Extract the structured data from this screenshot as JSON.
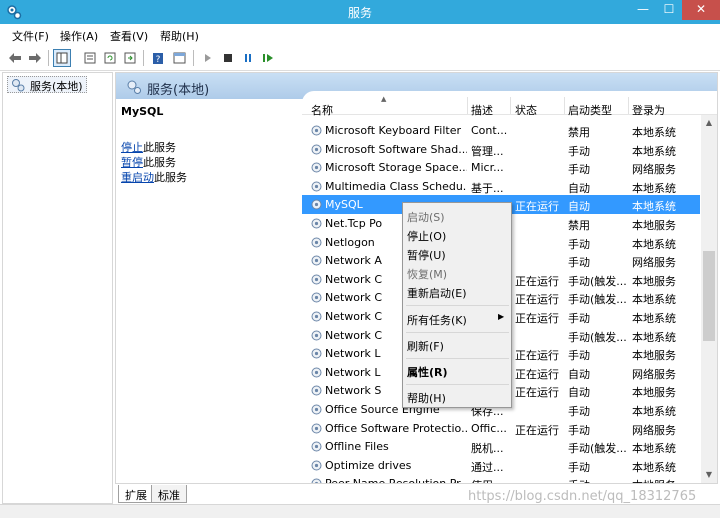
{
  "window": {
    "title": "服务",
    "icon": "services-gear-icon"
  },
  "window_controls": {
    "minimize": "—",
    "maximize": "☐",
    "close": "✕"
  },
  "menubar": [
    "文件(F)",
    "操作(A)",
    "查看(V)",
    "帮助(H)"
  ],
  "toolbar": {
    "icons": [
      "back-arrow-icon",
      "forward-arrow-icon",
      "console-tree-icon",
      "properties-icon",
      "refresh-icon",
      "export-list-icon",
      "help-icon",
      "mmc-view-icon",
      "play-icon",
      "stop-icon",
      "pause-icon",
      "restart-icon"
    ]
  },
  "tree": {
    "node": "服务(本地)"
  },
  "pane": {
    "header": "服务(本地)",
    "service_name": "MySQL",
    "actions": [
      {
        "link": "停止",
        "rest": "此服务"
      },
      {
        "link": "暂停",
        "rest": "此服务"
      },
      {
        "link": "重启动",
        "rest": "此服务"
      }
    ]
  },
  "columns": {
    "name": "名称",
    "desc": "描述",
    "status": "状态",
    "startup": "启动类型",
    "logon": "登录为"
  },
  "rows": [
    {
      "name": "Microsoft Keyboard Filter",
      "desc": "Cont...",
      "status": "",
      "startup": "禁用",
      "logon": "本地系统"
    },
    {
      "name": "Microsoft Software Shad...",
      "desc": "管理...",
      "status": "",
      "startup": "手动",
      "logon": "本地系统"
    },
    {
      "name": "Microsoft Storage Space...",
      "desc": "Micr...",
      "status": "",
      "startup": "手动",
      "logon": "网络服务"
    },
    {
      "name": "Multimedia Class Schedu...",
      "desc": "基于...",
      "status": "",
      "startup": "自动",
      "logon": "本地系统"
    },
    {
      "name": "MySQL",
      "desc": "",
      "status": "正在运行",
      "startup": "自动",
      "logon": "本地系统"
    },
    {
      "name": "Net.Tcp Po",
      "desc": "",
      "status": "",
      "startup": "禁用",
      "logon": "本地服务"
    },
    {
      "name": "Netlogon",
      "desc": "",
      "status": "",
      "startup": "手动",
      "logon": "本地系统"
    },
    {
      "name": "Network A",
      "desc": "",
      "status": "",
      "startup": "手动",
      "logon": "网络服务"
    },
    {
      "name": "Network C",
      "desc": "",
      "status": "正在运行",
      "startup": "手动(触发...",
      "logon": "本地服务"
    },
    {
      "name": "Network C",
      "desc": "",
      "status": "正在运行",
      "startup": "手动(触发...",
      "logon": "本地系统"
    },
    {
      "name": "Network C",
      "desc": "",
      "status": "正在运行",
      "startup": "手动",
      "logon": "本地系统"
    },
    {
      "name": "Network C",
      "desc": "",
      "status": "",
      "startup": "手动(触发...",
      "logon": "本地系统"
    },
    {
      "name": "Network L",
      "desc": "",
      "status": "正在运行",
      "startup": "手动",
      "logon": "本地服务"
    },
    {
      "name": "Network L",
      "desc": "",
      "status": "正在运行",
      "startup": "自动",
      "logon": "网络服务"
    },
    {
      "name": "Network S",
      "desc": "",
      "status": "正在运行",
      "startup": "自动",
      "logon": "本地服务"
    },
    {
      "name": "Office Source Engine",
      "desc": "保存...",
      "status": "",
      "startup": "手动",
      "logon": "本地系统"
    },
    {
      "name": "Office Software Protectio...",
      "desc": "Offic...",
      "status": "正在运行",
      "startup": "手动",
      "logon": "网络服务"
    },
    {
      "name": "Offline Files",
      "desc": "脱机...",
      "status": "",
      "startup": "手动(触发...",
      "logon": "本地系统"
    },
    {
      "name": "Optimize drives",
      "desc": "通过...",
      "status": "",
      "startup": "手动",
      "logon": "本地系统"
    },
    {
      "name": "Peer Name Resolution Pr...",
      "desc": "使用...",
      "status": "",
      "startup": "手动",
      "logon": "本地服务"
    }
  ],
  "context_menu": {
    "start": "启动(S)",
    "stop": "停止(O)",
    "pause": "暂停(U)",
    "resume": "恢复(M)",
    "restart": "重新启动(E)",
    "all_tasks": "所有任务(K)",
    "refresh": "刷新(F)",
    "properties": "属性(R)",
    "help": "帮助(H)"
  },
  "tabs": [
    "扩展",
    "标准"
  ],
  "watermark": "https://blog.csdn.net/qq_18312765"
}
